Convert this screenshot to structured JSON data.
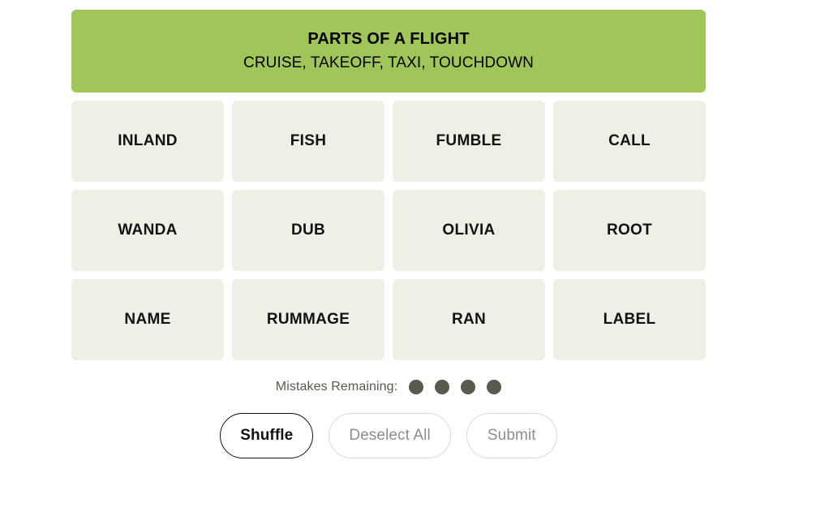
{
  "colors": {
    "page_background": "#ffffff",
    "solved_green": "#a0c65a",
    "tile_background": "#efefe6",
    "tile_text": "#121212",
    "mistakes_dot": "#5a594e",
    "disabled_text": "#8d8d8d",
    "disabled_border": "#d9d9d9",
    "enabled_border": "#121212"
  },
  "solved_categories": [
    {
      "title": "PARTS OF A FLIGHT",
      "words_line": "CRUISE, TAKEOFF, TAXI, TOUCHDOWN",
      "color": "#a0c65a"
    }
  ],
  "grid": {
    "rows": [
      [
        {
          "label": "INLAND"
        },
        {
          "label": "FISH"
        },
        {
          "label": "FUMBLE"
        },
        {
          "label": "CALL"
        }
      ],
      [
        {
          "label": "WANDA"
        },
        {
          "label": "DUB"
        },
        {
          "label": "OLIVIA"
        },
        {
          "label": "ROOT"
        }
      ],
      [
        {
          "label": "NAME"
        },
        {
          "label": "RUMMAGE"
        },
        {
          "label": "RAN"
        },
        {
          "label": "LABEL"
        }
      ]
    ]
  },
  "mistakes": {
    "label": "Mistakes Remaining:",
    "remaining": 4,
    "dots": [
      1,
      2,
      3,
      4
    ]
  },
  "actions": {
    "shuffle_label": "Shuffle",
    "deselect_label": "Deselect All",
    "submit_label": "Submit"
  }
}
